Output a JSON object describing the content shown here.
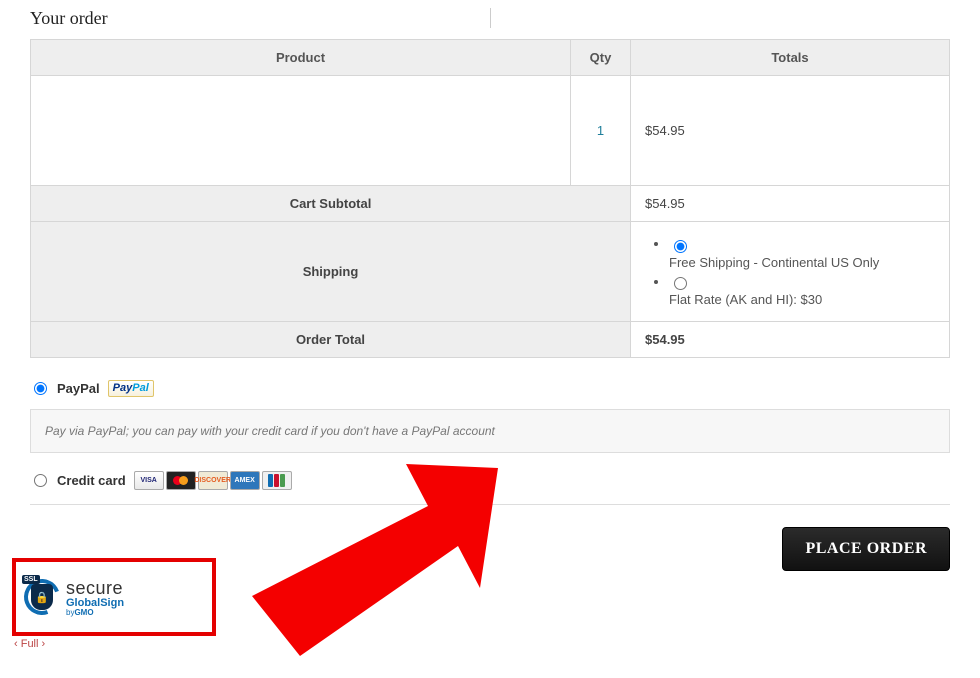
{
  "heading": "Your order",
  "table": {
    "headers": {
      "product": "Product",
      "qty": "Qty",
      "totals": "Totals"
    },
    "item": {
      "name": "",
      "qty": "1",
      "total": "$54.95"
    },
    "subtotal_label": "Cart Subtotal",
    "subtotal": "$54.95",
    "shipping_label": "Shipping",
    "shipping_options": {
      "free": "Free Shipping - Continental US Only",
      "flat": "Flat Rate (AK and HI): $30"
    },
    "order_total_label": "Order Total",
    "order_total": "$54.95"
  },
  "payment": {
    "paypal": {
      "name": "PayPal",
      "badge_pay": "Pay",
      "badge_pal": "Pal",
      "desc": "Pay via PayPal; you can pay with your credit card if you don't have a PayPal account"
    },
    "cc": {
      "name": "Credit card",
      "visa": "VISA",
      "disc": "DISCOVER",
      "amex": "AMEX"
    }
  },
  "place_order": "PLACE ORDER",
  "seal": {
    "ssl": "SSL",
    "lock": "🔒",
    "line1": "secure",
    "line2": "GlobalSign",
    "line3_prefix": "by",
    "line3_brand": "GMO"
  },
  "full_link": "‹ Full ›"
}
